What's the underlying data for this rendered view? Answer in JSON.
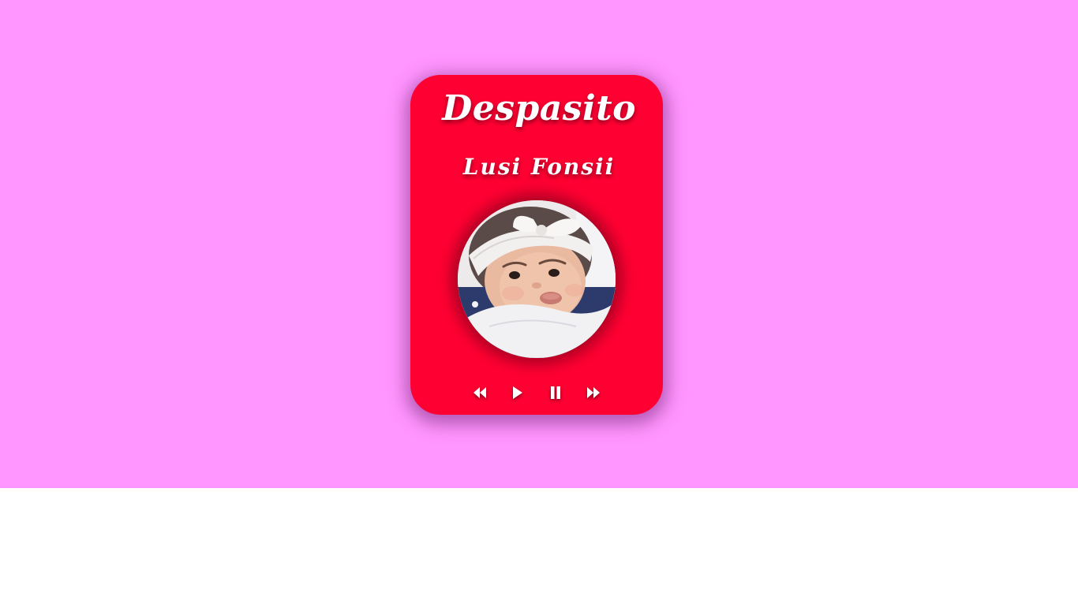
{
  "player": {
    "song_title": "Despasito",
    "artist": "Lusi Fonsii",
    "cover_image": "baby-pouting-photo",
    "colors": {
      "page_background": "#ff95ff",
      "card_background": "#ff0032",
      "text": "#ffffff"
    },
    "controls": [
      {
        "name": "rewind",
        "icon": "rewind-icon"
      },
      {
        "name": "play",
        "icon": "play-icon"
      },
      {
        "name": "pause",
        "icon": "pause-icon"
      },
      {
        "name": "fast-forward",
        "icon": "fast-forward-icon"
      }
    ]
  }
}
